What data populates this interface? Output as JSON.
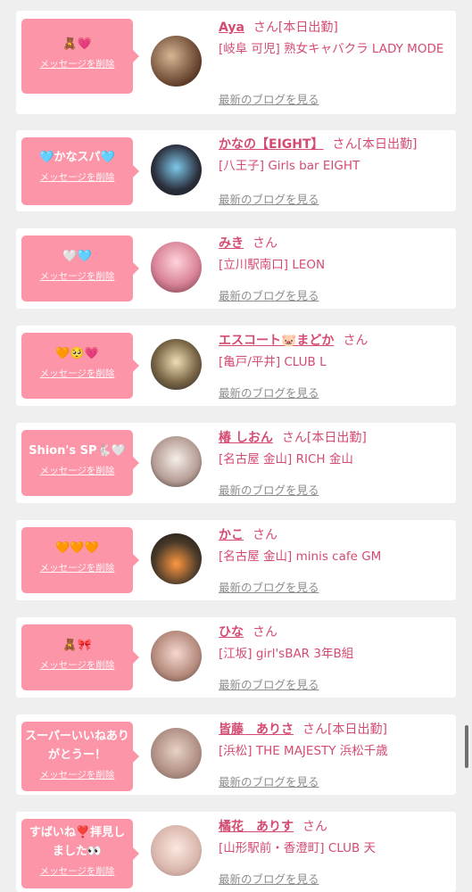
{
  "delete_label": "メッセージを削除",
  "blog_label": "最新のブログを見る",
  "san_label": "さん",
  "colors": {
    "accent": "#d44b71",
    "bubble": "#fd95a8",
    "background": "#efefef"
  },
  "entries": [
    {
      "message": "🧸💗",
      "name": "Aya",
      "badge": "[本日出勤]",
      "shop": "[岐阜 可児] 熟女キャバクラ LADY MODE"
    },
    {
      "message": "🩵かなスパ🩵",
      "name": "かなの【EIGHT】",
      "badge": "[本日出勤]",
      "shop": "[八王子] Girls bar EIGHT"
    },
    {
      "message": "🤍🩵",
      "name": "みき",
      "badge": "",
      "shop": "[立川駅南口] LEON"
    },
    {
      "message": "🧡🥺💗",
      "name": "エスコート🐷まどか",
      "badge": "",
      "shop": "[亀戸/平井] CLUB L"
    },
    {
      "message": "Shion's SP🐇🤍",
      "name": "椿 しおん",
      "badge": "[本日出勤]",
      "shop": "[名古屋 金山] RICH 金山"
    },
    {
      "message": "🧡🧡🧡",
      "name": "かこ",
      "badge": "",
      "shop": "[名古屋 金山] minis cafe GM"
    },
    {
      "message": "🧸🎀",
      "name": "ひな",
      "badge": "",
      "shop": "[江坂] girl'sBAR 3年B組"
    },
    {
      "message": "スーパーいいねありがとうー！",
      "name": "皆藤　ありさ",
      "badge": "[本日出勤]",
      "shop": "[浜松] THE MAJESTY 浜松千歳"
    },
    {
      "message": "すばいね❣️拝見しました👀",
      "name": "橘花　ありす",
      "badge": "",
      "shop": "[山形駅前・香澄町] CLUB 天"
    }
  ]
}
